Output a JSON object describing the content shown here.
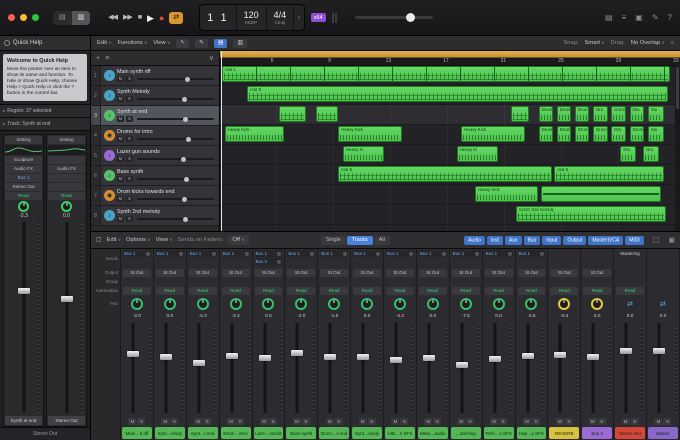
{
  "labels": {
    "mute": "M",
    "solo": "S"
  },
  "icons": {
    "rewind": "◀◀",
    "forward": "▶▶",
    "stop": "■",
    "play": "▶",
    "record": "●",
    "cycle": "⇄",
    "pointer_tool": "↖",
    "pencil_tool": "✎",
    "plus": "+",
    "list": "≡",
    "chevron": "∨",
    "triangle": "▸",
    "view_a": "▤",
    "view_b": "▥",
    "right_cluster": [
      "▤",
      "≡",
      "▣",
      "✎",
      "?"
    ],
    "mixer_window_a": "▢",
    "mixer_window_b": "▣",
    "lcd_note": "♪"
  },
  "topbar": {
    "cpu_badge": "x64",
    "lcd": {
      "beats": "1 1",
      "tempo": "120",
      "tempo_mode": "KEEP",
      "timesig": "4/4",
      "key": "Cmaj"
    }
  },
  "quick_help": {
    "title": "Quick Help",
    "heading": "Welcome to Quick Help",
    "body": "Move the pointer over an item to show its name and function. To hide or show Quick Help, choose Help > Quick Help or click the ? button in the control bar.",
    "region_row": "Region: 37 selected",
    "track_row": "Track: Synth at end"
  },
  "inspector": {
    "strips": [
      {
        "setting": "Setting",
        "module": "Sculpture",
        "audio_fx": "Audio FX",
        "send": "Bus 1",
        "output": "Stereo Out",
        "automation": "Read",
        "db": "-2.3",
        "fader": 62,
        "name": "Synth at end"
      },
      {
        "setting": "Setting",
        "module": "",
        "audio_fx": "Audio FX",
        "send": "",
        "output": "",
        "automation": "Read",
        "db": "0.0",
        "fader": 58,
        "name": "Stereo Out"
      }
    ],
    "footer": "Stereo Out"
  },
  "arrange_toolbar": {
    "menus": [
      "Edit",
      "Functions",
      "View"
    ],
    "snap_label": "Snap:",
    "snap_value": "Smart",
    "drag_label": "Drag:",
    "drag_value": "No Overlap"
  },
  "tracks": [
    {
      "num": "1",
      "name": "Main synth riff",
      "icon": "♪",
      "color": "#4aa3c9",
      "vol": 62
    },
    {
      "num": "2",
      "name": "Synth Melody",
      "icon": "♪",
      "color": "#4aa3c9",
      "vol": 58
    },
    {
      "num": "3",
      "name": "Synth at end",
      "icon": "♪",
      "color": "#58c06a",
      "vol": 60,
      "selected": true
    },
    {
      "num": "4",
      "name": "Drums for intro",
      "icon": "◉",
      "color": "#d98b3a",
      "vol": 64
    },
    {
      "num": "5",
      "name": "Lazer gun sounds",
      "icon": "♪",
      "color": "#9b6bd4",
      "vol": 57
    },
    {
      "num": "6",
      "name": "Bass synth",
      "icon": "♪",
      "color": "#58c06a",
      "vol": 61
    },
    {
      "num": "7",
      "name": "Drum kicks towards end",
      "icon": "◉",
      "color": "#d98b3a",
      "vol": 59
    },
    {
      "num": "8",
      "name": "Synth 2nd melody",
      "icon": "♪",
      "color": "#4aa3c9",
      "vol": 60
    }
  ],
  "ruler": {
    "numbers": [
      "5",
      "9",
      "13",
      "17",
      "21",
      "25",
      "29",
      "33"
    ]
  },
  "regions": [
    {
      "t": 0,
      "l": 0.5,
      "w": 98.5,
      "label": "Inst 1",
      "type": "loop"
    },
    {
      "t": 1,
      "l": 6,
      "w": 92.5,
      "label": "Inst 8",
      "type": "notes"
    },
    {
      "t": 2,
      "l": 13,
      "w": 6,
      "label": "",
      "type": "notes"
    },
    {
      "t": 2,
      "l": 21,
      "w": 5,
      "label": "",
      "type": "notes"
    },
    {
      "t": 2,
      "l": 64,
      "w": 4,
      "label": "",
      "type": "notes"
    },
    {
      "t": 2,
      "l": 70,
      "w": 3.2,
      "label": "Drum",
      "type": "drum"
    },
    {
      "t": 2,
      "l": 74,
      "w": 3.2,
      "label": "Drum",
      "type": "drum"
    },
    {
      "t": 2,
      "l": 78,
      "w": 3.2,
      "label": "Drum",
      "type": "drum"
    },
    {
      "t": 2,
      "l": 82,
      "w": 3.2,
      "label": "Dru",
      "type": "drum"
    },
    {
      "t": 2,
      "l": 86,
      "w": 3.2,
      "label": "Drum",
      "type": "drum"
    },
    {
      "t": 2,
      "l": 90,
      "w": 3.2,
      "label": "Dru",
      "type": "drum"
    },
    {
      "t": 2,
      "l": 94,
      "w": 3.5,
      "label": "Stu",
      "type": "drum"
    },
    {
      "t": 3,
      "l": 1,
      "w": 13,
      "label": "Heavy Kick",
      "type": "drum"
    },
    {
      "t": 3,
      "l": 26,
      "w": 14,
      "label": "Heavy Kick",
      "type": "drum"
    },
    {
      "t": 3,
      "l": 53,
      "w": 14,
      "label": "Heavy Kick",
      "type": "drum"
    },
    {
      "t": 3,
      "l": 70,
      "w": 3.2,
      "label": "Drum",
      "type": "drum"
    },
    {
      "t": 3,
      "l": 74,
      "w": 3.2,
      "label": "Drum",
      "type": "drum"
    },
    {
      "t": 3,
      "l": 78,
      "w": 3.2,
      "label": "Drum",
      "type": "drum"
    },
    {
      "t": 3,
      "l": 82,
      "w": 3.2,
      "label": "Drum",
      "type": "drum"
    },
    {
      "t": 3,
      "l": 86,
      "w": 3.2,
      "label": "Dru",
      "type": "drum"
    },
    {
      "t": 3,
      "l": 90,
      "w": 3.2,
      "label": "Drum",
      "type": "drum"
    },
    {
      "t": 3,
      "l": 94,
      "w": 3.5,
      "label": "Stu",
      "type": "drum"
    },
    {
      "t": 4,
      "l": 27,
      "w": 9,
      "label": "Heavy Ki",
      "type": "drum"
    },
    {
      "t": 4,
      "l": 52,
      "w": 9,
      "label": "Heavy Ki",
      "type": "drum"
    },
    {
      "t": 4,
      "l": 88,
      "w": 3.5,
      "label": "Dru",
      "type": "drum"
    },
    {
      "t": 4,
      "l": 93,
      "w": 3.5,
      "label": "Dru",
      "type": "drum"
    },
    {
      "t": 5,
      "l": 26,
      "w": 47,
      "label": "Inst 5",
      "type": "notes"
    },
    {
      "t": 5,
      "l": 73.5,
      "w": 24,
      "label": "Inst 5",
      "type": "notes"
    },
    {
      "t": 6,
      "l": 56,
      "w": 14,
      "label": "Heavy Kick",
      "type": "drum"
    },
    {
      "t": 6,
      "l": 70.5,
      "w": 26.5,
      "label": "",
      "type": "sustain"
    },
    {
      "t": 7,
      "l": 65,
      "w": 33,
      "label": "Synth 2nd melody",
      "type": "notes"
    }
  ],
  "mixer": {
    "toolbar": {
      "menus": [
        "Edit",
        "Options",
        "View"
      ],
      "sends_label": "Sends on Faders:",
      "sends_value": "Off",
      "view_modes": [
        "Single",
        "Tracks",
        "All"
      ],
      "active_view": "Tracks",
      "filters": [
        "Audio",
        "Inst",
        "Aux",
        "Bus",
        "Input",
        "Output",
        "Master|VCA",
        "MIDI"
      ]
    },
    "row_labels": [
      "Sends",
      "Output",
      "Group",
      "Automation",
      "Pan"
    ],
    "channels": [
      {
        "name": "Main…h riff",
        "color": "#55b755",
        "sends": [
          "Bus 1"
        ],
        "output": "St Out",
        "automation": "Read",
        "db": "-2.0",
        "fader": 62,
        "knob": "#35c06a"
      },
      {
        "name": "Synt…elody",
        "color": "#55b755",
        "sends": [
          "Bus 1"
        ],
        "output": "St Out",
        "automation": "Read",
        "db": "0.0",
        "fader": 58,
        "knob": "#35c06a"
      },
      {
        "name": "Synt…t end",
        "color": "#55b755",
        "sends": [
          "Bus 1"
        ],
        "output": "St Out",
        "automation": "Read",
        "db": "-6.3",
        "fader": 52,
        "knob": "#35c06a"
      },
      {
        "name": "Drum…intro",
        "color": "#55b755",
        "sends": [
          "Bus 1"
        ],
        "output": "St Out",
        "automation": "Read",
        "db": "-3.3",
        "fader": 60,
        "knob": "#35c06a"
      },
      {
        "name": "Laze…ounds",
        "color": "#55b755",
        "sends": [
          "Bus 1",
          "Bus 2"
        ],
        "output": "St Out",
        "automation": "Read",
        "db": "0.0",
        "fader": 57,
        "knob": "#35c06a"
      },
      {
        "name": "Bass synth",
        "color": "#55b755",
        "sends": [
          "Bus 1"
        ],
        "output": "St Out",
        "automation": "Read",
        "db": "-2.0",
        "fader": 63,
        "knob": "#35c06a"
      },
      {
        "name": "Drum…s end",
        "color": "#55b755",
        "sends": [
          "Bus 1"
        ],
        "output": "St Out",
        "automation": "Read",
        "db": "-1.6",
        "fader": 59,
        "knob": "#35c06a"
      },
      {
        "name": "Synt…elody",
        "color": "#55b755",
        "sends": [
          "Bus 1"
        ],
        "output": "St Out",
        "automation": "Read",
        "db": "0.0",
        "fader": 58,
        "knob": "#35c06a"
      },
      {
        "name": "Hits…n SFX",
        "color": "#55b755",
        "sends": [
          "Bus 1"
        ],
        "output": "St Out",
        "automation": "Read",
        "db": "-4.2",
        "fader": 55,
        "knob": "#35c06a"
      },
      {
        "name": "Meta…audio",
        "color": "#55b755",
        "sends": [
          "Bus 1"
        ],
        "output": "St Out",
        "automation": "Read",
        "db": "0.0",
        "fader": 57,
        "knob": "#35c06a"
      },
      {
        "name": "…anching",
        "color": "#55b755",
        "sends": [
          "Bus 1"
        ],
        "output": "St Out",
        "automation": "Read",
        "db": "-7.5",
        "fader": 50,
        "knob": "#35c06a"
      },
      {
        "name": "Tech…o SFX",
        "color": "#55b755",
        "sends": [
          "Bus 1"
        ],
        "output": "St Out",
        "automation": "Read",
        "db": "0.0",
        "fader": 56,
        "knob": "#35c06a"
      },
      {
        "name": "Hap…y SFX",
        "color": "#55b755",
        "sends": [
          "Bus 1"
        ],
        "output": "St Out",
        "automation": "Read",
        "db": "-2.6",
        "fader": 60,
        "knob": "#35c06a"
      },
      {
        "name": "REVERB",
        "color": "#d6c23e",
        "sends": [],
        "output": "St Out",
        "automation": "Read",
        "db": "-0.4",
        "fader": 61,
        "knob": "#e3c93f"
      },
      {
        "name": "Bus 2",
        "color": "#9b6bd4",
        "sends": [],
        "output": "St Out",
        "automation": "Read",
        "db": "0.0",
        "fader": 58,
        "knob": "#e3c93f"
      },
      {
        "name": "Stereo Out",
        "color": "#d6453a",
        "sends": [],
        "top": "Mastering",
        "output": "",
        "automation": "Read",
        "db": "0.0",
        "fader": 65,
        "pan": "arrows"
      },
      {
        "name": "Master",
        "color": "#8a68c9",
        "sends": [],
        "output": "",
        "automation": "",
        "db": "0.0",
        "fader": 65,
        "pan": "arrows"
      }
    ]
  }
}
